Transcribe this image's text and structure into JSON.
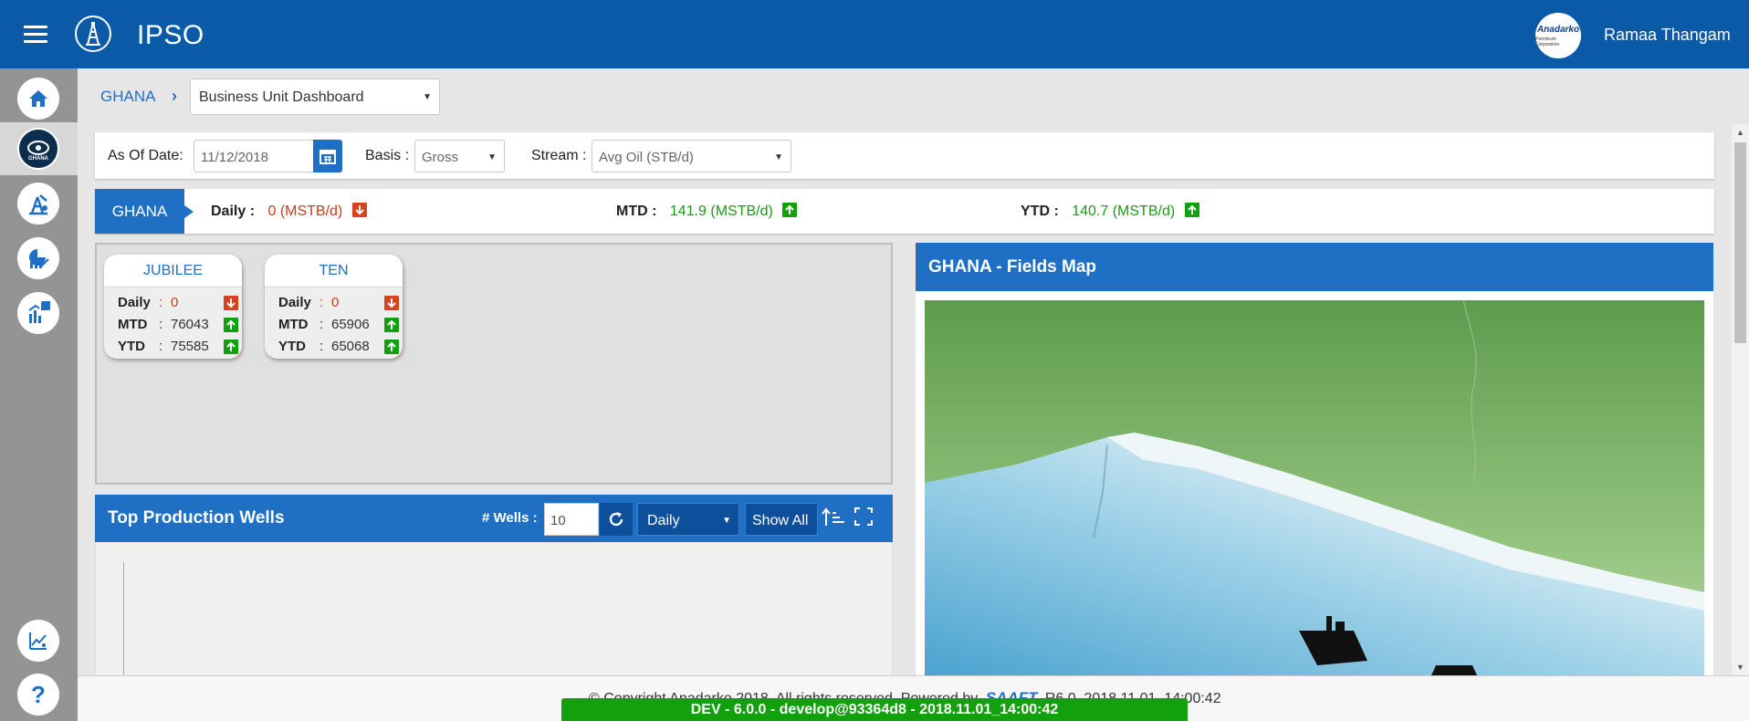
{
  "app": {
    "title": "IPSO",
    "menu_icon": "hamburger-menu-icon",
    "logo_icon": "drilling-rig-logo-icon"
  },
  "user": {
    "name": "Ramaa Thangam",
    "avatar_text_1": "Anadarko",
    "avatar_text_2": "Petroleum Corporation"
  },
  "rail": {
    "items": [
      {
        "name": "home",
        "icon": "home-icon"
      },
      {
        "name": "ghana",
        "icon": "ghana-region-icon",
        "label": "GHANA"
      },
      {
        "name": "rig",
        "icon": "oil-rig-icon"
      },
      {
        "name": "analytics",
        "icon": "analytics-chart-icon"
      },
      {
        "name": "reports",
        "icon": "bar-chart-report-icon"
      },
      {
        "name": "trends",
        "icon": "trend-tool-icon"
      },
      {
        "name": "help",
        "icon": "help-icon",
        "label": "?"
      }
    ]
  },
  "breadcrumb": {
    "root": "GHANA",
    "separator": "›",
    "dashboard_select": "Business Unit Dashboard"
  },
  "filters": {
    "as_of_label": "As Of Date:",
    "as_of_value": "11/12/2018",
    "basis_label": "Basis :",
    "basis_value": "Gross",
    "stream_label": "Stream :",
    "stream_value": "Avg Oil (STB/d)"
  },
  "summary": {
    "tag": "GHANA",
    "daily_label": "Daily :",
    "daily_value": "0 (MSTB/d)",
    "mtd_label": "MTD :",
    "mtd_value": "141.9 (MSTB/d)",
    "ytd_label": "YTD :",
    "ytd_value": "140.7 (MSTB/d)"
  },
  "fields": [
    {
      "name": "JUBILEE",
      "rows": [
        {
          "key": "Daily",
          "value": "0",
          "trend": "down"
        },
        {
          "key": "MTD",
          "value": "76043",
          "trend": "up"
        },
        {
          "key": "YTD",
          "value": "75585",
          "trend": "up"
        }
      ]
    },
    {
      "name": "TEN",
      "rows": [
        {
          "key": "Daily",
          "value": "0",
          "trend": "down"
        },
        {
          "key": "MTD",
          "value": "65906",
          "trend": "up"
        },
        {
          "key": "YTD",
          "value": "65068",
          "trend": "up"
        }
      ]
    }
  ],
  "wells": {
    "title": "Top Production Wells",
    "count_label": "# Wells :",
    "count_value": "10",
    "period_value": "Daily",
    "show_all_label": "Show All"
  },
  "map": {
    "title": "GHANA - Fields Map"
  },
  "footer": {
    "copyright": "© Copyright Anadarko 2018. All rights reserved. Powered by",
    "powered_by": "SAAFT",
    "version": "R6.0_2018.11.01_14:00:42",
    "dev_bar": "DEV - 6.0.0 - develop@93364d8 - 2018.11.01_14:00:42"
  },
  "colors": {
    "primary": "#0a5aa8",
    "accent": "#1f6fc5",
    "up": "#13a00d",
    "down": "#d7431c",
    "dev_bar": "#13a00d"
  }
}
